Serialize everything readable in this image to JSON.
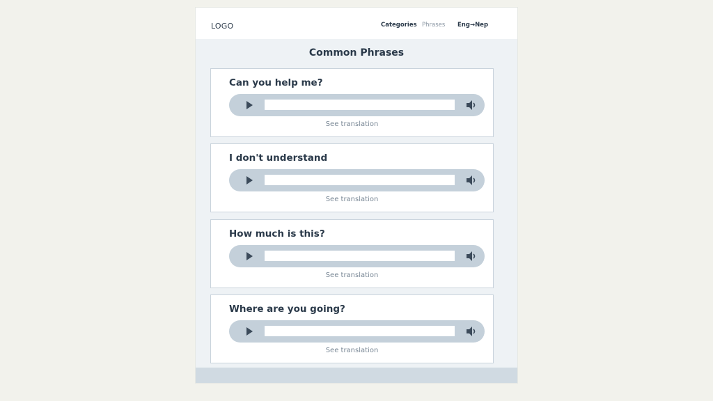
{
  "header": {
    "logo": "LOGO",
    "nav": {
      "categories": "Categories",
      "phrases": "Phrases",
      "language": "Eng→Nep"
    }
  },
  "page_title": "Common Phrases",
  "phrases": [
    {
      "text": "Can you help me?",
      "action": "See translation"
    },
    {
      "text": "I don't understand",
      "action": "See translation"
    },
    {
      "text": "How much is this?",
      "action": "See translation"
    },
    {
      "text": "Where are you going?",
      "action": "See translation"
    }
  ],
  "icons": {
    "play": "play-icon",
    "volume": "volume-icon"
  },
  "colors": {
    "page_background": "#f2f2ec",
    "content_background": "#eef2f5",
    "player_background": "#c4d0da",
    "text_dark": "#2b3a4a",
    "text_muted": "#7a8896",
    "footer": "#d0dae2"
  }
}
